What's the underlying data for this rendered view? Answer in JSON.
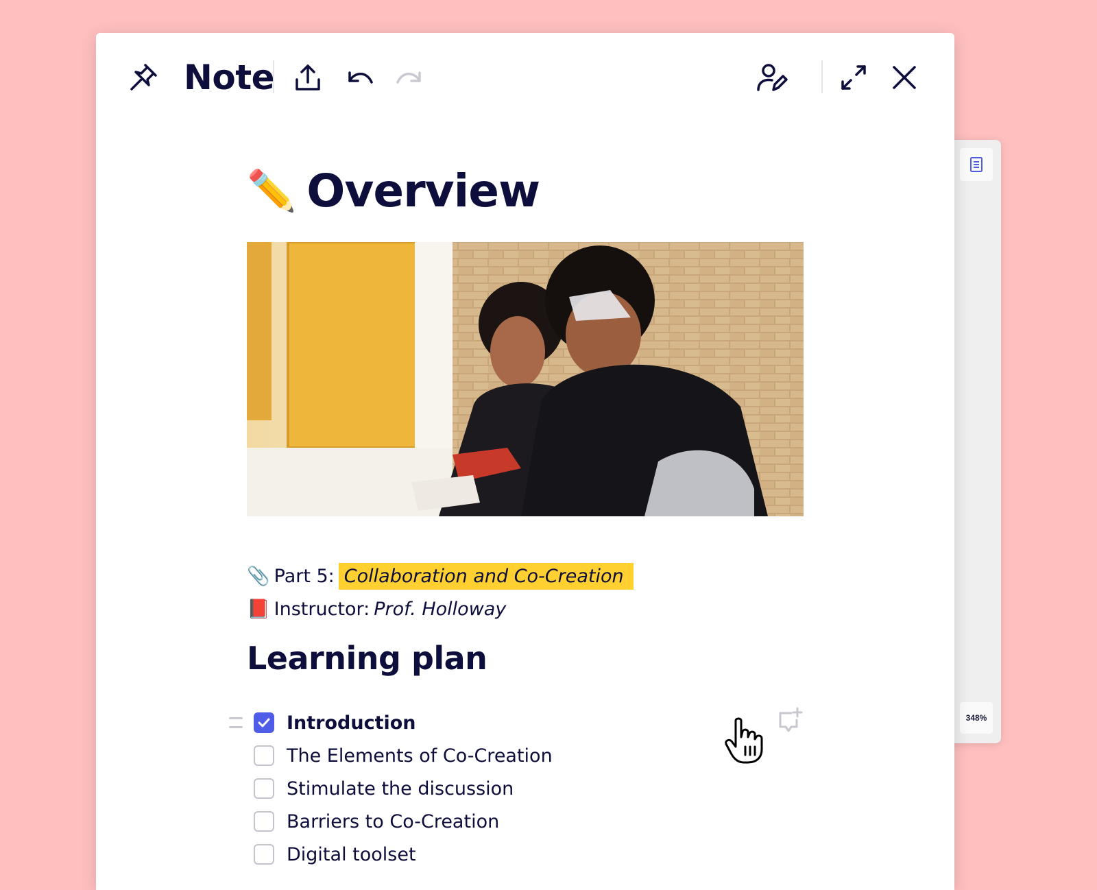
{
  "toolbar": {
    "title": "Note",
    "icons": {
      "pin": "pin-icon",
      "share": "share-upload-icon",
      "undo": "undo-icon",
      "redo": "redo-icon",
      "editors": "user-edit-icon",
      "expand": "expand-icon",
      "close": "close-icon"
    }
  },
  "document": {
    "title_emoji": "✏️",
    "title": "Overview",
    "image_description_icon": "students-photo",
    "meta": {
      "part_emoji": "📎",
      "part_label": "Part 5:",
      "part_value": "Collaboration and Co-Creation",
      "instructor_emoji": "📕",
      "instructor_label": "Instructor:",
      "instructor_value": "Prof. Holloway"
    },
    "section_title": "Learning plan",
    "todos": [
      {
        "label": "Introduction",
        "checked": true,
        "bold": true
      },
      {
        "label": "The Elements of Co-Creation",
        "checked": false,
        "bold": false
      },
      {
        "label": "Stimulate the discussion",
        "checked": false,
        "bold": false
      },
      {
        "label": "Barriers to Co-Creation",
        "checked": false,
        "bold": false
      },
      {
        "label": "Digital toolset",
        "checked": false,
        "bold": false
      }
    ]
  },
  "side_panel": {
    "zoom": "348%"
  },
  "colors": {
    "background": "#ffbfbf",
    "accent": "#4e5ce8",
    "highlight": "#ffd02f",
    "text": "#0e0e3d"
  }
}
